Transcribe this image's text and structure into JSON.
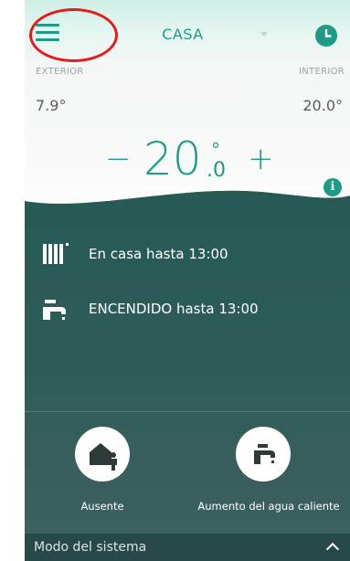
{
  "header": {
    "title": "CASA",
    "menu_icon": "hamburger-menu-icon",
    "schedule_icon": "clock-icon"
  },
  "temps": {
    "exterior_label": "EXTERIOR",
    "interior_label": "INTERIOR",
    "exterior_value": "7.9°",
    "interior_value": "20.0°",
    "setpoint_int": "20",
    "setpoint_dec": ".0",
    "setpoint_deg": "°",
    "minus_label": "−",
    "plus_label": "+",
    "info_label": "i"
  },
  "status": [
    {
      "icon": "radiator-icon",
      "text": "En casa hasta 13:00"
    },
    {
      "icon": "water-tap-icon",
      "text": "ENCENDIDO hasta 13:00"
    }
  ],
  "actions": {
    "away_label": "Ausente",
    "hot_water_label": "Aumento del agua caliente"
  },
  "footer": {
    "system_mode_label": "Modo del sistema"
  },
  "colors": {
    "accent": "#1d9b86",
    "panel": "#2c5c58",
    "highlight": "#e21c1c"
  }
}
